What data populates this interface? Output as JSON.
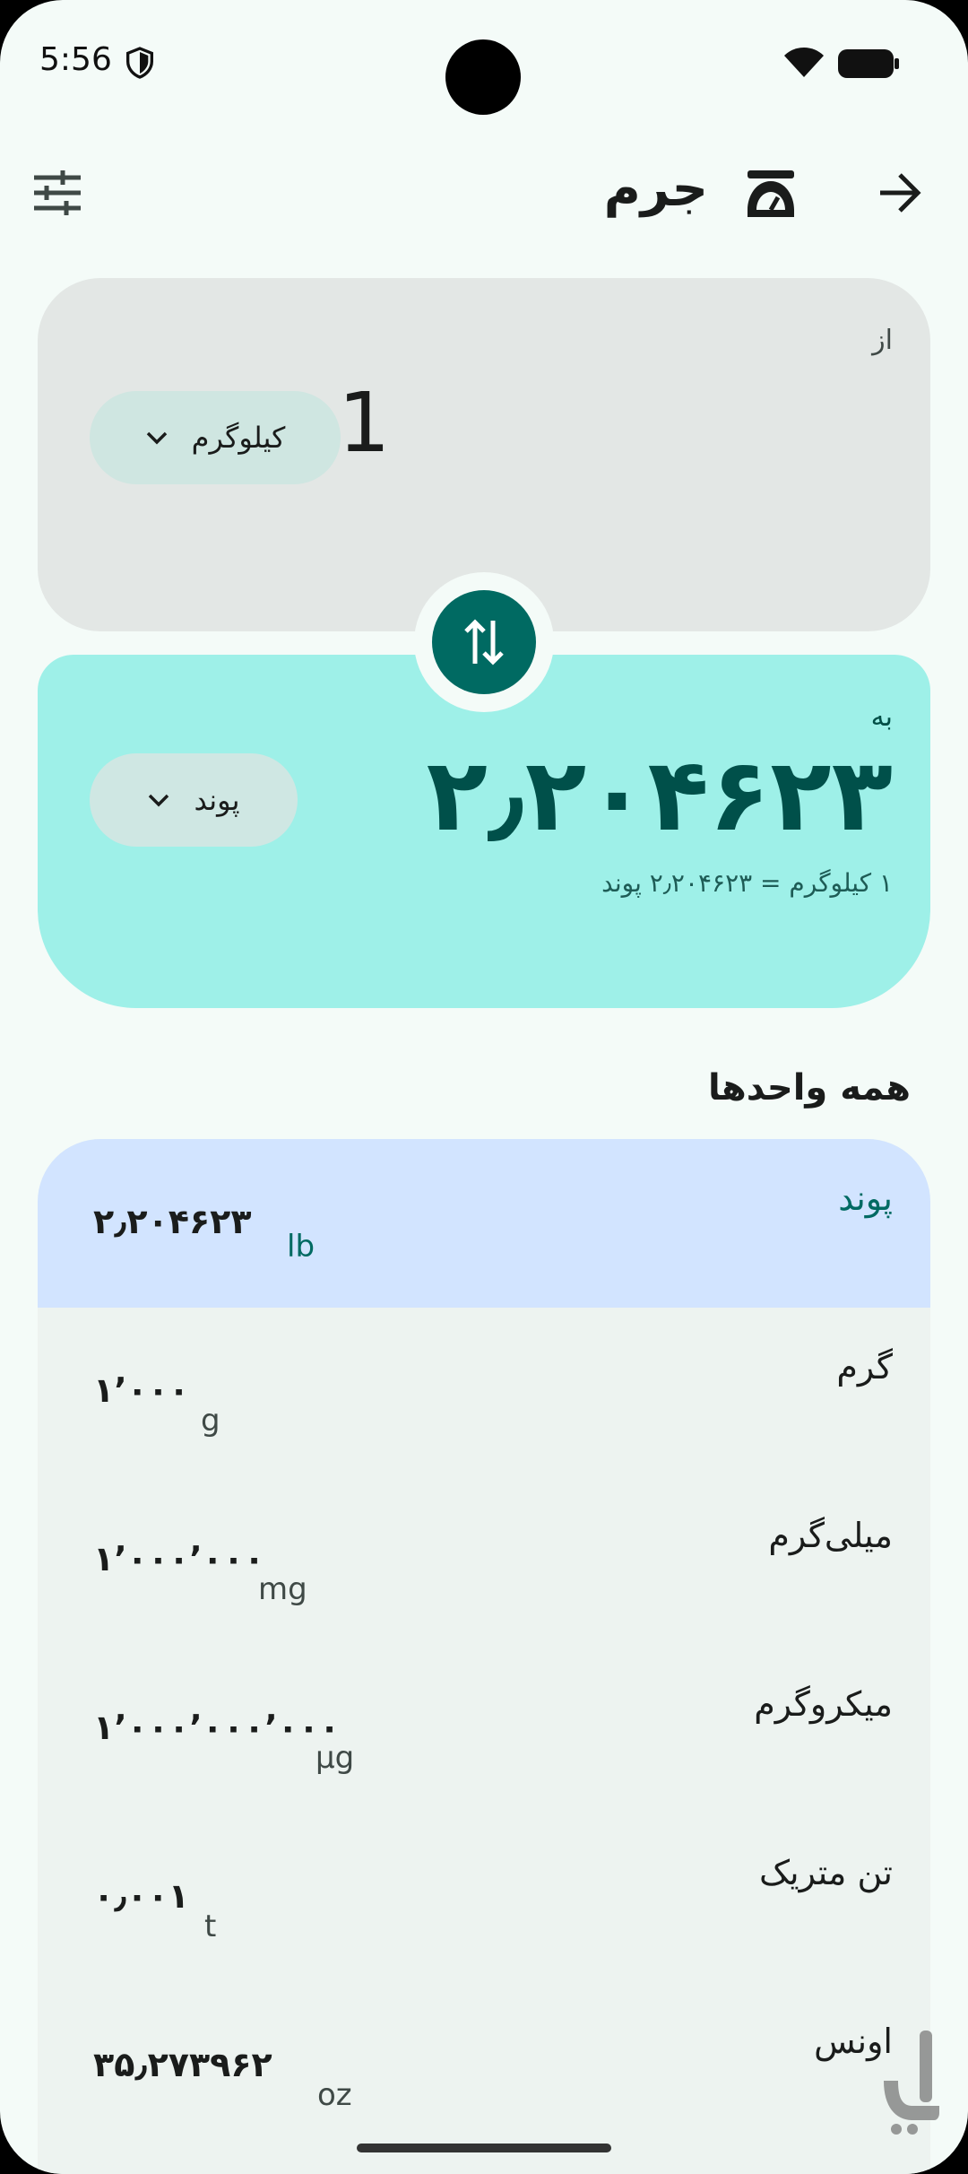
{
  "status": {
    "time": "5:56"
  },
  "header": {
    "title": "جرم"
  },
  "from": {
    "label": "از",
    "value": "1",
    "unit": "کیلوگرم"
  },
  "to": {
    "label": "به",
    "value": "۲٫۲۰۴۶۲۳",
    "unit": "پوند",
    "note": "۱ کیلوگرم = ۲٫۲۰۴۶۲۳ پوند"
  },
  "section_title": "همه واحدها",
  "units": [
    {
      "name": "پوند",
      "value": "۲٫۲۰۴۶۲۳",
      "symbol": "lb",
      "selected": true
    },
    {
      "name": "گرم",
      "value": "۱٬۰۰۰",
      "symbol": "g"
    },
    {
      "name": "میلی‌گرم",
      "value": "۱٬۰۰۰٬۰۰۰",
      "symbol": "mg"
    },
    {
      "name": "میکروگرم",
      "value": "۱٬۰۰۰٬۰۰۰٬۰۰۰",
      "symbol": "µg"
    },
    {
      "name": "تن متریک",
      "value": "۰٫۰۰۱",
      "symbol": "t"
    },
    {
      "name": "اونس",
      "value": "۳۵٫۲۷۳۹۶۲",
      "symbol": "oz"
    }
  ],
  "colors": {
    "accent": "#006a62",
    "to_card": "#9ef0e8",
    "selected_row": "#d2e4ff"
  }
}
